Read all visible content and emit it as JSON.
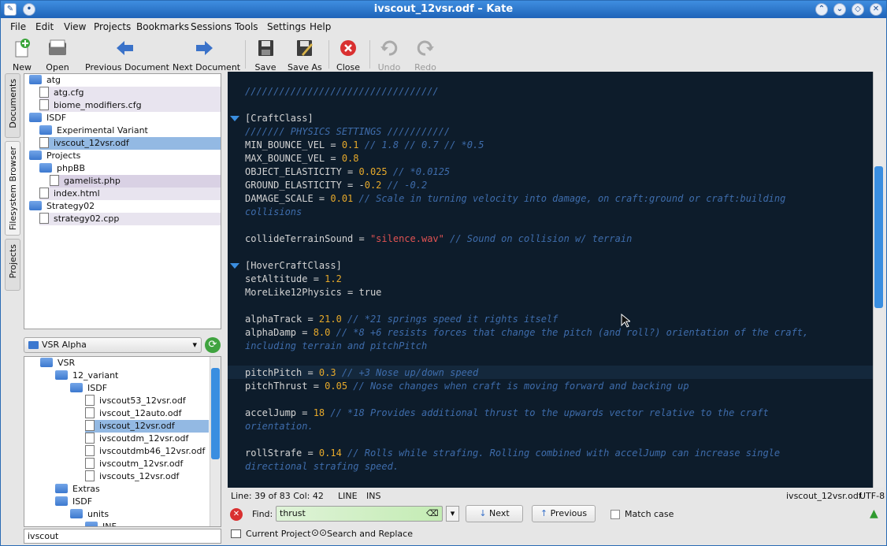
{
  "window": {
    "title": "ivscout_12vsr.odf – Kate"
  },
  "menu": [
    "File",
    "Edit",
    "View",
    "Projects",
    "Bookmarks",
    "Sessions",
    "Tools",
    "Settings",
    "Help"
  ],
  "toolbar": {
    "new": "New",
    "open": "Open",
    "prev_doc": "Previous Document",
    "next_doc": "Next Document",
    "save": "Save",
    "save_as": "Save As",
    "close": "Close",
    "undo": "Undo",
    "redo": "Redo"
  },
  "side_tabs": {
    "documents": "Documents",
    "filesystem": "Filesystem Browser",
    "projects": "Projects"
  },
  "doc_tree": [
    {
      "label": "atg",
      "kind": "folder"
    },
    {
      "label": "atg.cfg",
      "kind": "file"
    },
    {
      "label": "biome_modifiers.cfg",
      "kind": "file"
    },
    {
      "label": "ISDF",
      "kind": "folder"
    },
    {
      "label": "Experimental Variant",
      "kind": "folder"
    },
    {
      "label": "ivscout_12vsr.odf",
      "kind": "file"
    },
    {
      "label": "Projects",
      "kind": "folder"
    },
    {
      "label": "phpBB",
      "kind": "folder"
    },
    {
      "label": "gamelist.php",
      "kind": "file"
    },
    {
      "label": "index.html",
      "kind": "file"
    },
    {
      "label": "Strategy02",
      "kind": "folder"
    },
    {
      "label": "strategy02.cpp",
      "kind": "file"
    }
  ],
  "fs": {
    "location": "VSR Alpha",
    "filter": "ivscout"
  },
  "fs_tree": [
    {
      "label": "VSR",
      "kind": "folder"
    },
    {
      "label": "12_variant",
      "kind": "folder"
    },
    {
      "label": "ISDF",
      "kind": "folder"
    },
    {
      "label": "ivscout53_12vsr.odf",
      "kind": "file"
    },
    {
      "label": "ivscout_12auto.odf",
      "kind": "file"
    },
    {
      "label": "ivscout_12vsr.odf",
      "kind": "file"
    },
    {
      "label": "ivscoutdm_12vsr.odf",
      "kind": "file"
    },
    {
      "label": "ivscoutdmb46_12vsr.odf",
      "kind": "file"
    },
    {
      "label": "ivscoutm_12vsr.odf",
      "kind": "file"
    },
    {
      "label": "ivscouts_12vsr.odf",
      "kind": "file"
    },
    {
      "label": "Extras",
      "kind": "folder"
    },
    {
      "label": "ISDF",
      "kind": "folder"
    },
    {
      "label": "units",
      "kind": "folder"
    },
    {
      "label": "INF",
      "kind": "folder"
    }
  ],
  "code_lines": [
    [
      [
        "c",
        "//////////////////////////////////"
      ]
    ],
    [],
    [
      [
        "t",
        "[CraftClass]"
      ]
    ],
    [
      [
        "c",
        "/////// PHYSICS SETTINGS ///////////"
      ]
    ],
    [
      [
        "t",
        "MIN_BOUNCE_VEL = "
      ],
      [
        "n",
        "0.1"
      ],
      [
        "c",
        " // 1.8 // 0.7 // *0.5"
      ]
    ],
    [
      [
        "t",
        "MAX_BOUNCE_VEL = "
      ],
      [
        "n",
        "0.8"
      ]
    ],
    [
      [
        "t",
        "OBJECT_ELASTICITY = "
      ],
      [
        "n",
        "0.025"
      ],
      [
        "c",
        " // *0.0125"
      ]
    ],
    [
      [
        "t",
        "GROUND_ELASTICITY = -"
      ],
      [
        "n",
        "0.2"
      ],
      [
        "c",
        " // -0.2"
      ]
    ],
    [
      [
        "t",
        "DAMAGE_SCALE = "
      ],
      [
        "n",
        "0.01"
      ],
      [
        "c",
        " // Scale in turning velocity into damage, on craft:ground or craft:building"
      ]
    ],
    [
      [
        "c",
        "collisions"
      ]
    ],
    [],
    [
      [
        "t",
        "collideTerrainSound = "
      ],
      [
        "s",
        "\"silence.wav\""
      ],
      [
        "c",
        " // Sound on collision w/ terrain"
      ]
    ],
    [],
    [
      [
        "t",
        "[HoverCraftClass]"
      ]
    ],
    [
      [
        "t",
        "setAltitude = "
      ],
      [
        "n",
        "1.2"
      ]
    ],
    [
      [
        "t",
        "MoreLike12Physics = true"
      ]
    ],
    [],
    [
      [
        "t",
        "alphaTrack = "
      ],
      [
        "n",
        "21.0"
      ],
      [
        "c",
        " // *21 springs speed it rights itself"
      ]
    ],
    [
      [
        "t",
        "alphaDamp = "
      ],
      [
        "n",
        "8.0"
      ],
      [
        "c",
        " // *8 +6 resists forces that change the pitch (and roll?) orientation of the craft,"
      ]
    ],
    [
      [
        "c",
        "including terrain and pitchPitch"
      ]
    ],
    [],
    [
      [
        "t",
        "pitchPitch = "
      ],
      [
        "n",
        "0.3"
      ],
      [
        "c",
        " // +3 Nose up/down speed"
      ]
    ],
    [
      [
        "t",
        "pitchThrust = "
      ],
      [
        "n",
        "0.05"
      ],
      [
        "c",
        " // Nose changes when craft is moving forward and backing up"
      ]
    ],
    [],
    [
      [
        "t",
        "accelJump = "
      ],
      [
        "n",
        "18"
      ],
      [
        "c",
        " // *18 Provides additional thrust to the upwards vector relative to the craft"
      ]
    ],
    [
      [
        "c",
        "orientation."
      ]
    ],
    [],
    [
      [
        "t",
        "rollStrafe = "
      ],
      [
        "n",
        "0.14"
      ],
      [
        "c",
        " // Rolls while strafing. Rolling combined with accelJump can increase single"
      ]
    ],
    [
      [
        "c",
        "directional strafing speed."
      ]
    ]
  ],
  "status": {
    "position": "Line: 39 of 83 Col: 42",
    "mode": "LINE",
    "insert": "INS",
    "filename": "ivscout_12vsr.odf",
    "encoding": "UTF-8"
  },
  "find": {
    "label": "Find:",
    "value": "thrust",
    "next": "Next",
    "previous": "Previous",
    "match_case": "Match case"
  },
  "bottom_tabs": {
    "current_project": "Current Project",
    "search_replace": "Search and Replace"
  }
}
